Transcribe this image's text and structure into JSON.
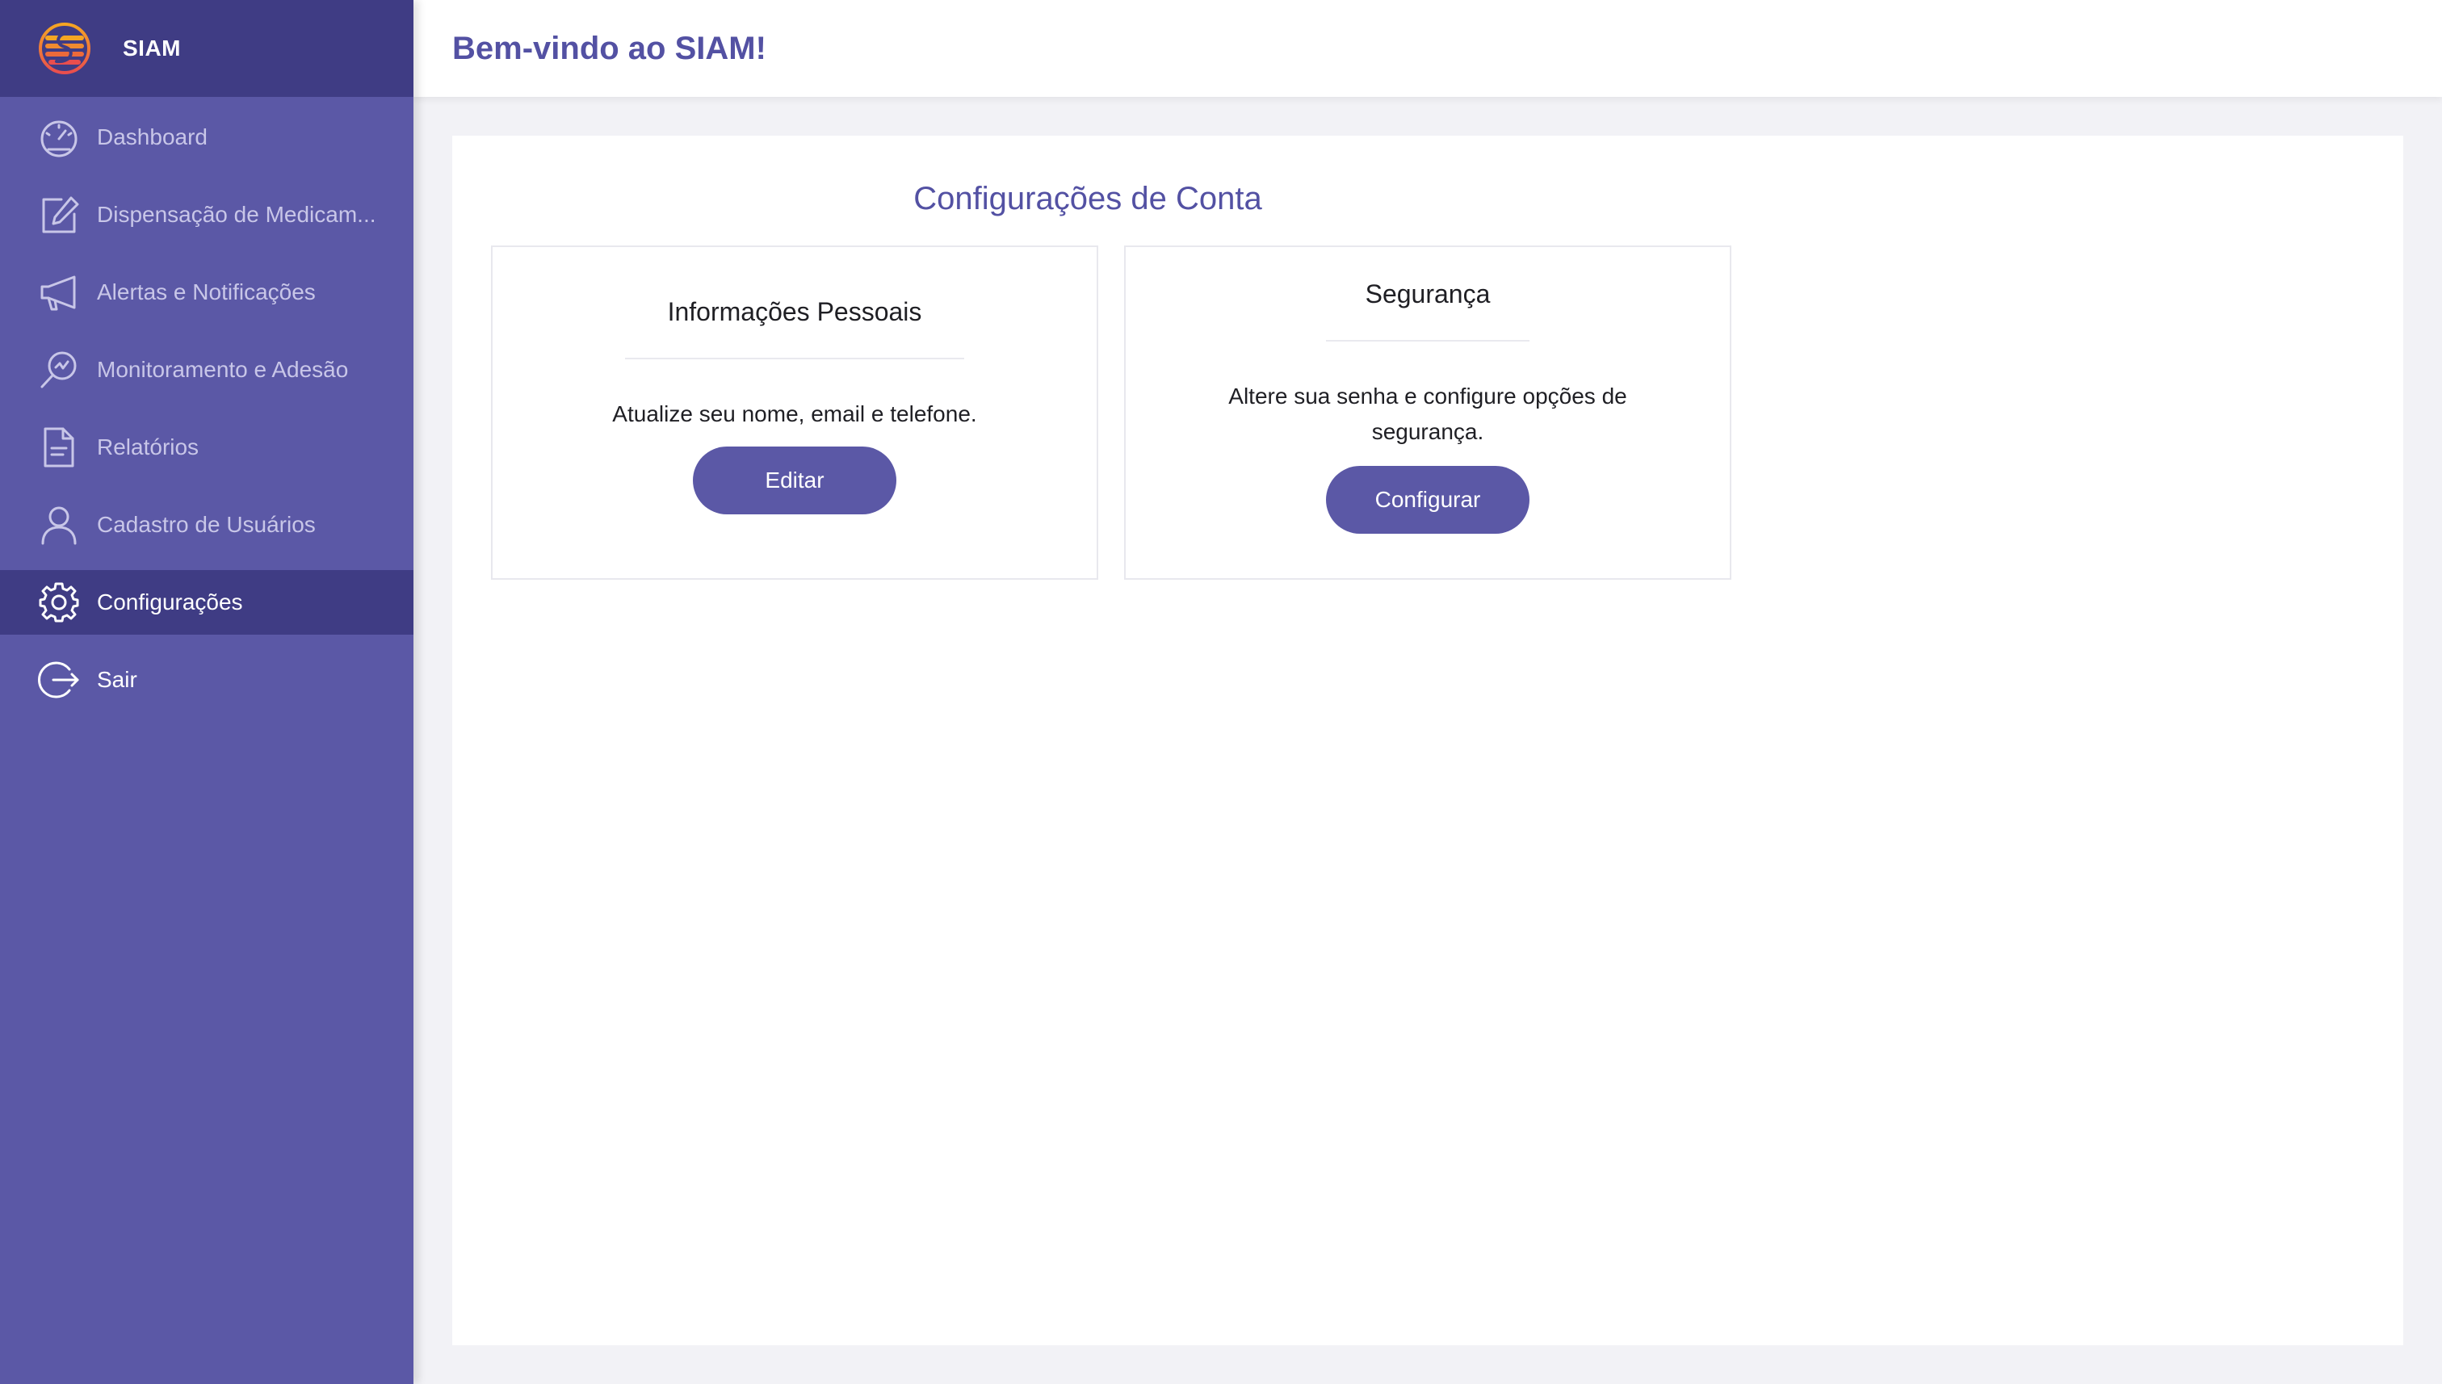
{
  "brand": {
    "name": "SIAM",
    "logo_icon": "siam-logo",
    "logo_colors": [
      "#f5a623",
      "#e94e4e"
    ]
  },
  "colors": {
    "sidebar_bg": "#5b58a6",
    "sidebar_active_bg": "#3f3c84",
    "accent": "#5351a3",
    "button_bg": "#5b58a6"
  },
  "sidebar": {
    "items": [
      {
        "label": "Dashboard",
        "icon": "speedometer-icon",
        "active": false
      },
      {
        "label": "Dispensação de Medicam...",
        "icon": "edit-icon",
        "active": false
      },
      {
        "label": "Alertas e Notificações",
        "icon": "megaphone-icon",
        "active": false
      },
      {
        "label": "Monitoramento e Adesão",
        "icon": "search-chart-icon",
        "active": false
      },
      {
        "label": "Relatórios",
        "icon": "document-icon",
        "active": false
      },
      {
        "label": "Cadastro de Usuários",
        "icon": "user-icon",
        "active": false
      },
      {
        "label": "Configurações",
        "icon": "gear-icon",
        "active": true
      },
      {
        "label": "Sair",
        "icon": "logout-icon",
        "active": false
      }
    ]
  },
  "header": {
    "welcome": "Bem-vindo ao SIAM!"
  },
  "settings": {
    "title": "Configurações de Conta",
    "cards": [
      {
        "title": "Informações Pessoais",
        "description": "Atualize seu nome, email e telefone.",
        "button": "Editar"
      },
      {
        "title": "Segurança",
        "description_line1": "Altere sua senha e configure opções de",
        "description_line2": "segurança.",
        "button": "Configurar"
      }
    ]
  }
}
